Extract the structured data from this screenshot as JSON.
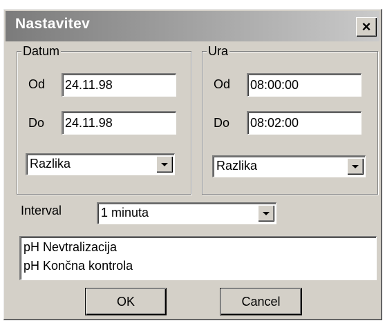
{
  "window": {
    "title": "Nastavitev",
    "close_glyph": "×"
  },
  "datum": {
    "legend": "Datum",
    "od_label": "Od",
    "od_value": "24.11.98",
    "do_label": "Do",
    "do_value": "24.11.98",
    "mode": "Razlika"
  },
  "ura": {
    "legend": "Ura",
    "od_label": "Od",
    "od_value": "08:00:00",
    "do_label": "Do",
    "do_value": "08:02:00",
    "mode": "Razlika"
  },
  "interval": {
    "label": "Interval",
    "value": "1 minuta"
  },
  "list": {
    "items": [
      "pH Nevtralizacija",
      "pH Končna kontrola"
    ]
  },
  "buttons": {
    "ok": "OK",
    "cancel": "Cancel"
  }
}
